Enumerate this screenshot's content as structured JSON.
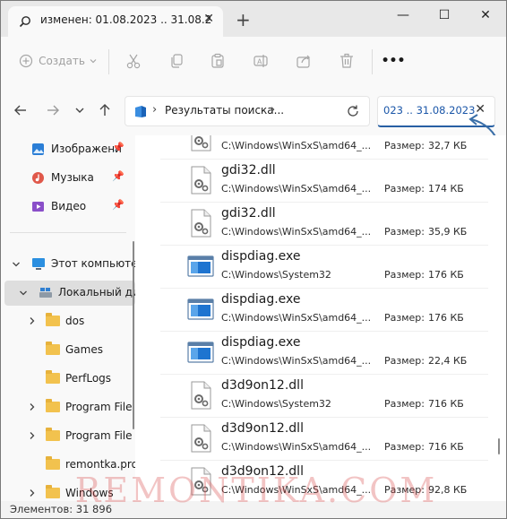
{
  "tab": {
    "title": "изменен: 01.08.2023 .. 31.08.2",
    "close_icon": "close-icon",
    "new_tab": "+"
  },
  "window_controls": {
    "minimize": "—",
    "maximize": "☐",
    "close": "✕"
  },
  "commandbar": {
    "create_label": "Создать",
    "icons": [
      "new-icon",
      "cut-icon",
      "copy-icon",
      "paste-icon",
      "rename-icon",
      "share-icon",
      "delete-icon",
      "more-icon"
    ],
    "more": "•••"
  },
  "navigation": {
    "address": "Результаты поиска...",
    "address_separator": "›",
    "search_value": "023 .. 31.08.2023",
    "accent": "#2860a4"
  },
  "sidebar": {
    "pinned": [
      {
        "label": "Изображени",
        "icon": "pictures-icon"
      },
      {
        "label": "Музыка",
        "icon": "music-icon"
      },
      {
        "label": "Видео",
        "icon": "video-icon"
      }
    ],
    "this_pc": {
      "label": "Этот компьюте",
      "icon": "computer-icon"
    },
    "local_disk": {
      "label": "Локальный ди",
      "icon": "drive-icon"
    },
    "folders": [
      {
        "label": "dos",
        "expandable": true
      },
      {
        "label": "Games",
        "expandable": false
      },
      {
        "label": "PerfLogs",
        "expandable": false
      },
      {
        "label": "Program File",
        "expandable": true
      },
      {
        "label": "Program File",
        "expandable": true
      },
      {
        "label": "remontka.pro",
        "expandable": false
      },
      {
        "label": "Windows",
        "expandable": true
      }
    ]
  },
  "results": {
    "size_label": "Размер:",
    "items": [
      {
        "name": "",
        "path": "C:\\Windows\\WinSxS\\amd64_...",
        "size": "32,7 КБ",
        "icon": "dll-file-icon"
      },
      {
        "name": "gdi32.dll",
        "path": "C:\\Windows\\WinSxS\\amd64_...",
        "size": "174 КБ",
        "icon": "dll-file-icon"
      },
      {
        "name": "gdi32.dll",
        "path": "C:\\Windows\\WinSxS\\amd64_...",
        "size": "35,9 КБ",
        "icon": "dll-file-icon"
      },
      {
        "name": "dispdiag.exe",
        "path": "C:\\Windows\\System32",
        "size": "176 КБ",
        "icon": "exe-file-icon"
      },
      {
        "name": "dispdiag.exe",
        "path": "C:\\Windows\\WinSxS\\amd64_...",
        "size": "176 КБ",
        "icon": "exe-file-icon"
      },
      {
        "name": "dispdiag.exe",
        "path": "C:\\Windows\\WinSxS\\amd64_...",
        "size": "22,4 КБ",
        "icon": "exe-file-icon"
      },
      {
        "name": "d3d9on12.dll",
        "path": "C:\\Windows\\System32",
        "size": "716 КБ",
        "icon": "dll-file-icon"
      },
      {
        "name": "d3d9on12.dll",
        "path": "C:\\Windows\\WinSxS\\amd64_...",
        "size": "716 КБ",
        "icon": "dll-file-icon"
      },
      {
        "name": "d3d9on12.dll",
        "path": "C:\\Windows\\WinSxS\\amd64_...",
        "size": "92,8 КБ",
        "icon": "dll-file-icon"
      }
    ]
  },
  "status": {
    "text": "Элементов: 31 896"
  },
  "watermark": "REMONTIKA.COM"
}
